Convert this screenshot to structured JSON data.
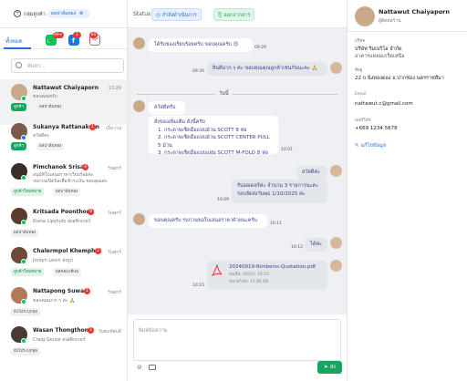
{
  "left": {
    "group_label": "กลุ่มลูกค้า",
    "filter_chip": "ผลปาล์มทอง",
    "tab_all": "ทั้งหมด",
    "badges": {
      "line": "99+",
      "facebook": "1",
      "email": "60"
    },
    "search_placeholder": "ค้นหา...",
    "conversations": [
      {
        "name": "Nattawut Chaiyaporn",
        "msg": "ขอบคุณครับ",
        "time": "13:29",
        "tags": [
          "ลูกค้า",
          "ผลปาล์มทอง"
        ],
        "unread": ""
      },
      {
        "name": "Sukanya Rattanakorn",
        "msg": "สวัสดีค่ะ",
        "time": "เมื่อวาน",
        "tags": [
          "ลูกค้า",
          "ผลปาล์มทอง"
        ],
        "unread": "1"
      },
      {
        "name": "Pimchanok Srisai",
        "msg": "อนุมัติใบเสนอราคาเรียบร้อยค่ะ",
        "msg2": "รบกวนเปิดบิลเพื่อชำระเงิน ขอบคุณค่ะ",
        "time": "วันศุกร์",
        "tags": [
          "ลูกค้าใหม่หมาย",
          "ผลปาล์มทอง"
        ],
        "unread": "4"
      },
      {
        "name": "Kritsada Poonthong",
        "msg": "Kiana Lipshutz ส่งสติกเกอร์",
        "time": "วันศุกร์",
        "tags": [
          "ผลปาล์มทอง"
        ],
        "unread": "9"
      },
      {
        "name": "Chalermpol Khemphet",
        "msg": "Jordyn Levin ส่งรูป",
        "time": "วันศุกร์",
        "tags": [
          "ลูกค้าใหม่หมาย",
          "ผลของแท้แพ"
        ],
        "unread": "2"
      },
      {
        "name": "Nattapong Suwan",
        "msg": "ขอบคุณมาก ๆ ค่ะ 🙏",
        "time": "วันศุกร์",
        "tags": [
          "ยังไม่ระบุกลุ่ม"
        ],
        "unread": "1"
      },
      {
        "name": "Wasan Thongthong",
        "msg": "Craig Gouse ส่งสติกเกอร์",
        "time": "วันพฤหัสบดี",
        "tags": [
          "ยังไม่ระบุกลุ่ม"
        ],
        "unread": "1"
      }
    ]
  },
  "mid": {
    "status_label": "Status",
    "status_btn": "กำลังดำเนินการ",
    "close_btn": "ออกจากสาร",
    "day_divider": "วันนี้",
    "messages": [
      {
        "dir": "in",
        "text": "ได้รับของเรียบร้อยครับ ขอบคุณครับ 😊",
        "time": "09:29"
      },
      {
        "dir": "out",
        "text": "ยินดีมาก ๆ ค่ะ ขอบคุณคุณลูกค้าเช่นกันนะคะ 🙏",
        "time": "09:30"
      },
      {
        "dir": "in",
        "text": "สวัสดีครับ",
        "time": ""
      },
      {
        "dir": "in",
        "lines": [
          "สั่งของเพิ่มเติม ดังนี้ครับ",
          "1. กระดาษเช็ดมือแบบม้วน SCOTT 8 ห่อ",
          "2. กระดาษเช็ดมือแบบม้วน SCOTT CENTER PULL 5 ม้วน",
          "3. กระดาษเช็ดมือแบบแผ่น SCOTT M-FOLD 8 ห่อ"
        ],
        "time": "10:01"
      },
      {
        "dir": "out",
        "text": "สวัสดีค่ะ",
        "time": ""
      },
      {
        "dir": "out",
        "lines": [
          "รับออเดอร์ค่ะ จำนวน 3 รายการนะคะ",
          "รอบจัดส่งวันพุธ 1/10/2025 ค่ะ"
        ],
        "time": "10:09"
      },
      {
        "dir": "in",
        "text": "ขอบคุณครับ รบกวนขอใบเสนอราคาด้วยนะครับ",
        "time": "10:11"
      },
      {
        "dir": "out",
        "text": "ได้ค่ะ",
        "time": "10:12"
      },
      {
        "dir": "out",
        "file": {
          "name": "20240919-Rimberio-Quotation.pdf",
          "meta1": "ส่งเมื่อ: 06/10, 10:15",
          "meta2": "ขนาดไฟล์: 13.96 KB"
        },
        "time": "10:15"
      }
    ],
    "compose_placeholder": "พิมพ์ข้อความ",
    "send_label": "ส่ง"
  },
  "right": {
    "name": "Nattawut Chaiyaporn",
    "role": "ผู้ติดต่อร้าน",
    "company_label": "บริษัท",
    "company_value": "บริษัท ริมเบริโอ จำกัด",
    "company_value2": "อาคารแหลมเกร็ดเหนือ",
    "address_label": "ที่อยู่",
    "address_value": "22 ถ.นิ่งทองดอง อ.ปากช่อง นครราชสีมา",
    "email_label": "Email",
    "email_value": "nattawut.c@gmail.com",
    "phone_label": "เบอร์โทร",
    "phone_value": "+669 1234 5678",
    "edit_label": "แก้ไขข้อมูล"
  },
  "colors": {
    "accent": "#1f6fd6",
    "green": "#17a55f",
    "chat_bg": "#eef0f3"
  }
}
